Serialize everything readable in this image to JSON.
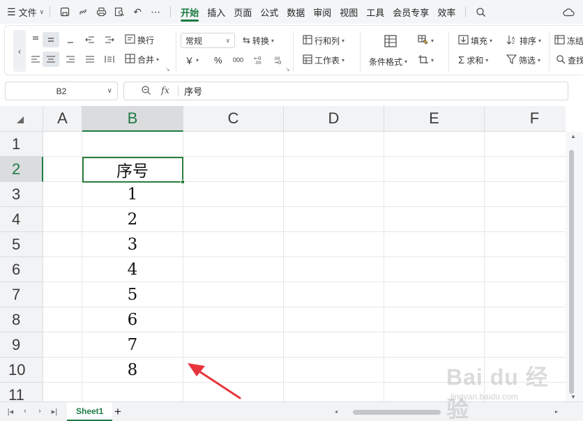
{
  "menubar": {
    "menu_label": "文件",
    "tabs": [
      "开始",
      "插入",
      "页面",
      "公式",
      "数据",
      "审阅",
      "视图",
      "工具",
      "会员专享",
      "效率"
    ],
    "active_tab": "开始"
  },
  "ribbon": {
    "wrap_text": "换行",
    "merge": "合并",
    "number_format": "常规",
    "convert": "转换",
    "currency_symbol": "￥",
    "percent_symbol": "%",
    "thousands_symbol": "000",
    "rows_cols": "行和列",
    "worksheet": "工作表",
    "cond_format": "条件格式",
    "fill": "填充",
    "sort": "排序",
    "freeze": "冻结",
    "sum": "求和",
    "filter": "筛选",
    "find": "查找"
  },
  "formula_bar": {
    "name_box": "B2",
    "fx_label": "fx",
    "value": "序号"
  },
  "grid": {
    "columns": [
      "A",
      "B",
      "C",
      "D",
      "E",
      "F"
    ],
    "rows": [
      "1",
      "2",
      "3",
      "4",
      "5",
      "6",
      "7",
      "8",
      "9",
      "10",
      "11"
    ],
    "selected_column": "B",
    "selected_row": "2",
    "column_b_values": [
      "",
      "序号",
      "1",
      "2",
      "3",
      "4",
      "5",
      "6",
      "7",
      "8",
      ""
    ]
  },
  "sheets": {
    "tabs": [
      "Sheet1"
    ],
    "add_label": "+"
  },
  "watermark": {
    "main": "Bai du 经验",
    "sub": "jingyan.baidu.com"
  },
  "colors": {
    "accent": "#1a7a44",
    "selection_border": "#2a7d3a",
    "arrow": "#e8343c"
  }
}
